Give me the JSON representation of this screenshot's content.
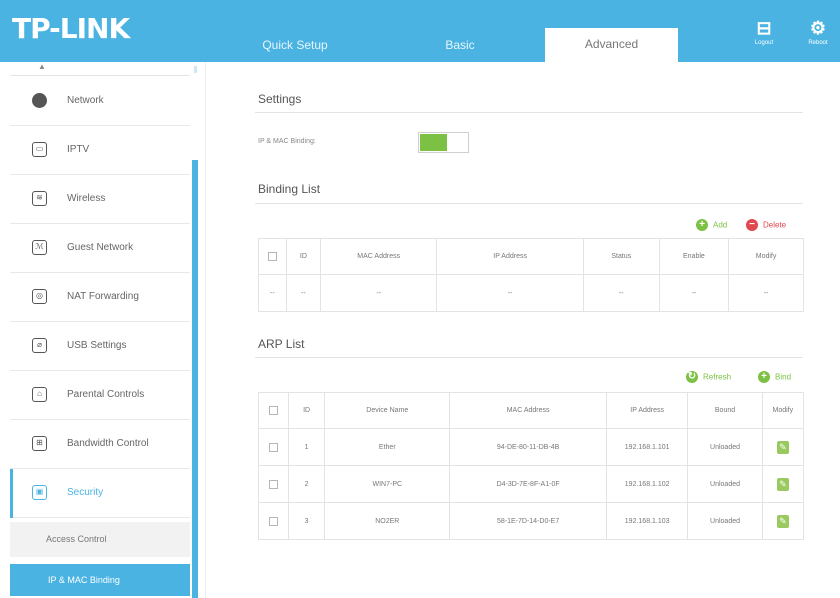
{
  "header": {
    "logo": "TP-LINK",
    "tabs": [
      "Quick Setup",
      "Basic",
      "Advanced"
    ],
    "buttons": [
      {
        "label": "Logout",
        "icon": "logout-icon"
      },
      {
        "label": "Reboot",
        "icon": "gear-icon"
      }
    ]
  },
  "sidebar": {
    "items": [
      {
        "label": "Network",
        "icon": "globe-icon"
      },
      {
        "label": "IPTV",
        "icon": "tv-icon"
      },
      {
        "label": "Wireless",
        "icon": "wireless-icon"
      },
      {
        "label": "Guest Network",
        "icon": "guest-network-icon"
      },
      {
        "label": "NAT Forwarding",
        "icon": "nat-forwarding-icon"
      },
      {
        "label": "USB Settings",
        "icon": "usb-icon"
      },
      {
        "label": "Parental Controls",
        "icon": "parental-controls-icon"
      },
      {
        "label": "Bandwidth Control",
        "icon": "bandwidth-icon"
      },
      {
        "label": "Security",
        "icon": "lock-icon",
        "active": true
      }
    ],
    "subitems": [
      {
        "label": "Access Control"
      },
      {
        "label": "IP & MAC Binding",
        "selected": true
      }
    ]
  },
  "settings": {
    "title": "Settings",
    "binding_label": "IP & MAC Binding:",
    "binding_enabled": true
  },
  "binding_list": {
    "title": "Binding List",
    "add_label": "Add",
    "delete_label": "Delete",
    "columns": [
      "",
      "ID",
      "MAC Address",
      "IP Address",
      "Status",
      "Enable",
      "Modify"
    ],
    "rows": [
      [
        "--",
        "--",
        "--",
        "--",
        "--",
        "--",
        "--"
      ]
    ]
  },
  "arp_list": {
    "title": "ARP List",
    "refresh_label": "Refresh",
    "bind_label": "Bind",
    "columns": [
      "",
      "ID",
      "Device Name",
      "MAC Address",
      "IP Address",
      "Bound",
      "Modify"
    ],
    "rows": [
      {
        "id": "1",
        "device": "Ether",
        "mac": "94-DE-80-11-DB-4B",
        "ip": "192.168.1.101",
        "bound": "Unloaded"
      },
      {
        "id": "2",
        "device": "WIN7-PC",
        "mac": "D4-3D-7E-8F-A1-0F",
        "ip": "192.168.1.102",
        "bound": "Unloaded"
      },
      {
        "id": "3",
        "device": "NO2ER",
        "mac": "58-1E-7D-14-D0-E7",
        "ip": "192.168.1.103",
        "bound": "Unloaded"
      }
    ]
  },
  "colors": {
    "brand": "#4ab3e2",
    "green": "#7cc143",
    "red": "#e0474f"
  }
}
